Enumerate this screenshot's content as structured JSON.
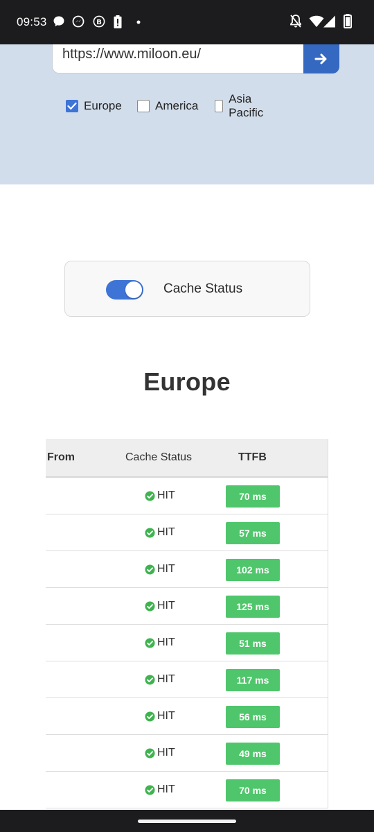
{
  "status_bar": {
    "time": "09:53",
    "left_icons": [
      "chat-bubble-icon",
      "messenger-icon",
      "business-b-icon",
      "battery-alert-icon",
      "dot-icon"
    ],
    "right_icons": [
      "notifications-off-icon",
      "wifi-icon",
      "signal-icon",
      "battery-icon"
    ]
  },
  "search": {
    "url": "https://www.miloon.eu/",
    "go_icon": "arrow-right-icon"
  },
  "regions": [
    {
      "label": "Europe",
      "checked": true
    },
    {
      "label": "America",
      "checked": false
    },
    {
      "label": "Asia Pacific",
      "checked": false
    }
  ],
  "cache_toggle": {
    "label": "Cache Status",
    "on": true
  },
  "results": {
    "heading": "Europe",
    "columns": [
      "From",
      "Cache Status",
      "TTFB"
    ],
    "rows": [
      {
        "from": "",
        "status": "HIT",
        "ttfb": "70 ms"
      },
      {
        "from": "",
        "status": "HIT",
        "ttfb": "57 ms"
      },
      {
        "from": "",
        "status": "HIT",
        "ttfb": "102 ms"
      },
      {
        "from": "",
        "status": "HIT",
        "ttfb": "125 ms"
      },
      {
        "from": "",
        "status": "HIT",
        "ttfb": "51 ms"
      },
      {
        "from": "",
        "status": "HIT",
        "ttfb": "117 ms"
      },
      {
        "from": "",
        "status": "HIT",
        "ttfb": "56 ms"
      },
      {
        "from": "",
        "status": "HIT",
        "ttfb": "49 ms"
      },
      {
        "from": "",
        "status": "HIT",
        "ttfb": "70 ms"
      }
    ]
  },
  "colors": {
    "hero_bg": "#d2ddeb",
    "accent": "#3d74d6",
    "go_button": "#3569c1",
    "ttfb_badge": "#4fc66b",
    "hit_icon": "#3fb34f"
  }
}
